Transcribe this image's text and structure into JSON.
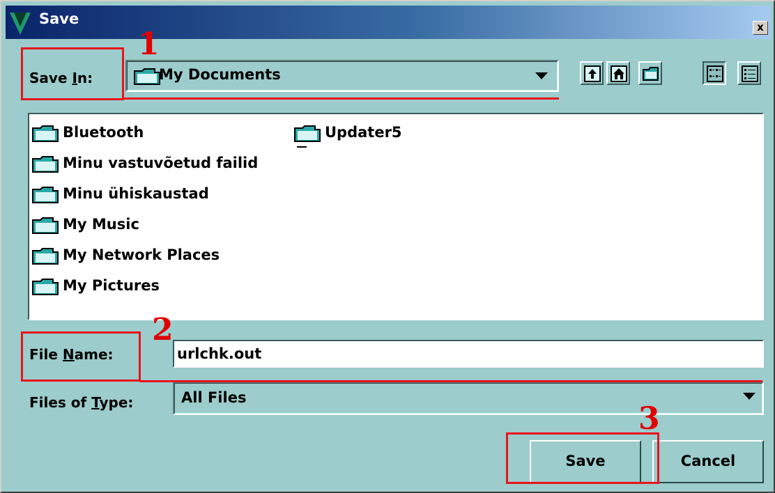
{
  "window": {
    "title": "Save",
    "close_label": "x"
  },
  "save_in": {
    "label_pre": "Save ",
    "label_mnemonic": "I",
    "label_post": "n:",
    "value": "My Documents"
  },
  "toolbar": {
    "buttons": [
      {
        "name": "up-one-level-icon"
      },
      {
        "name": "home-icon"
      },
      {
        "name": "new-folder-icon"
      },
      {
        "name": "list-view-icon",
        "pressed": true
      },
      {
        "name": "details-view-icon"
      }
    ]
  },
  "files": [
    {
      "name": "Bluetooth"
    },
    {
      "name": "Minu vastuvõetud failid"
    },
    {
      "name": "Minu ühiskaustad"
    },
    {
      "name": "My Music"
    },
    {
      "name": "My Network Places"
    },
    {
      "name": "My Pictures"
    },
    {
      "name": "Updater5"
    }
  ],
  "file_name": {
    "label_pre": "File ",
    "label_mnemonic": "N",
    "label_post": "ame:",
    "value": "urlchk.out"
  },
  "file_type": {
    "label_pre": "Files of ",
    "label_mnemonic": "T",
    "label_post": "ype:",
    "value": "All Files"
  },
  "actions": {
    "save_label": "Save",
    "cancel_label": "Cancel"
  },
  "annotations": [
    "1",
    "2",
    "3"
  ],
  "colors": {
    "dialog_bg": "#9ccccc",
    "title_bar_start": "#0a246a",
    "annotation_red": "#e8141c",
    "folder_teal": "#2aa8a8"
  }
}
